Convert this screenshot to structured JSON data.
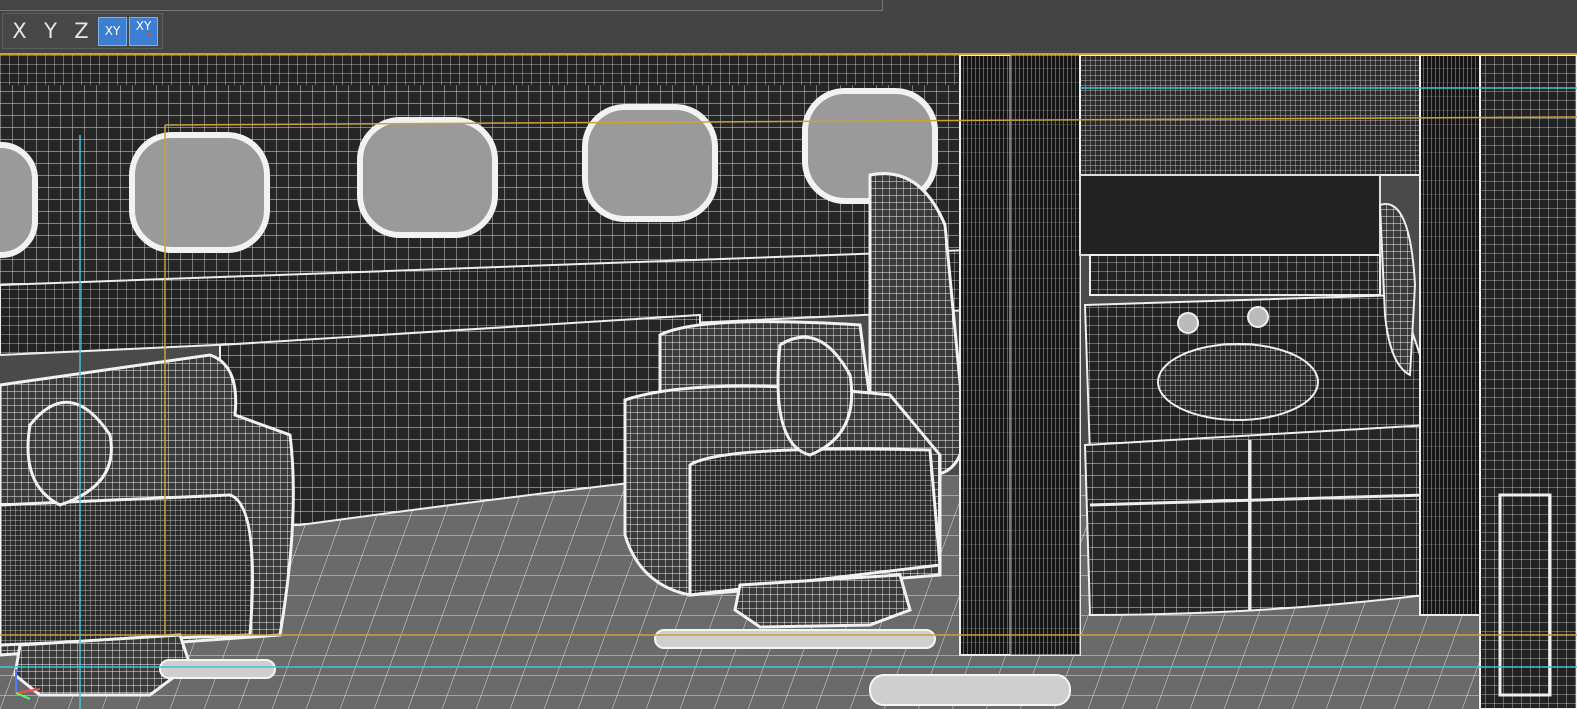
{
  "toolbar": {
    "axis_buttons": [
      {
        "label": "X",
        "active": false
      },
      {
        "label": "Y",
        "active": false
      },
      {
        "label": "Z",
        "active": false
      },
      {
        "label": "XY",
        "active": true
      },
      {
        "label": "XY",
        "active": true,
        "lock": true
      }
    ]
  },
  "viewport": {
    "content": "wireframe-aircraft-cabin",
    "colors": {
      "background": "#444444",
      "wire": "#e8e8e8",
      "wall": "#1a1a1a",
      "window_glass": "#9a9a9a",
      "floor": "#6e6e6e",
      "guide_orange": "#c9a33a",
      "guide_cyan": "#3ec7d6",
      "active_button": "#3c7fd0"
    }
  }
}
